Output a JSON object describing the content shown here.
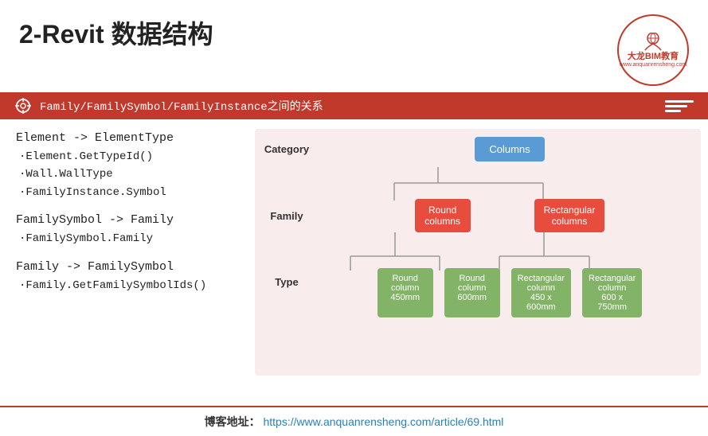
{
  "header": {
    "title": "2-Revit 数据结构",
    "logo": {
      "name": "大龙BIM教育",
      "url": "www.anquanrensheng.com"
    },
    "banner_text": "Family/FamilySymbol/FamilyInstance之间的关系"
  },
  "left": {
    "block1": {
      "heading": "Element -> ElementType",
      "bullets": [
        "·Element.GetTypeId()",
        "·Wall.WallType",
        "·FamilyInstance.Symbol"
      ]
    },
    "block2": {
      "heading": "FamilySymbol -> Family",
      "bullets": [
        "·FamilySymbol.Family"
      ]
    },
    "block3": {
      "heading": "Family -> FamilySymbol",
      "bullets": [
        "·Family.GetFamilySymbolIds()"
      ]
    }
  },
  "diagram": {
    "rows": [
      {
        "label": "Category",
        "boxes": [
          {
            "text": "Columns",
            "style": "blue"
          }
        ]
      },
      {
        "label": "Family",
        "boxes": [
          {
            "text": "Round\ncolumns",
            "style": "red"
          },
          {
            "text": "Rectangular\ncolumns",
            "style": "red"
          }
        ]
      },
      {
        "label": "Type",
        "boxes": [
          {
            "text": "Round\ncolumn\n450mm",
            "style": "green"
          },
          {
            "text": "Round\ncolumn\n600mm",
            "style": "green"
          },
          {
            "text": "Rectangular\ncolumn\n450 x\n600mm",
            "style": "green"
          },
          {
            "text": "Rectangular\ncolumn\n600 x\n750mm",
            "style": "green"
          }
        ]
      }
    ]
  },
  "footer": {
    "label": "博客地址：",
    "url": "https://www.anquanrensheng.com/article/69.html"
  }
}
